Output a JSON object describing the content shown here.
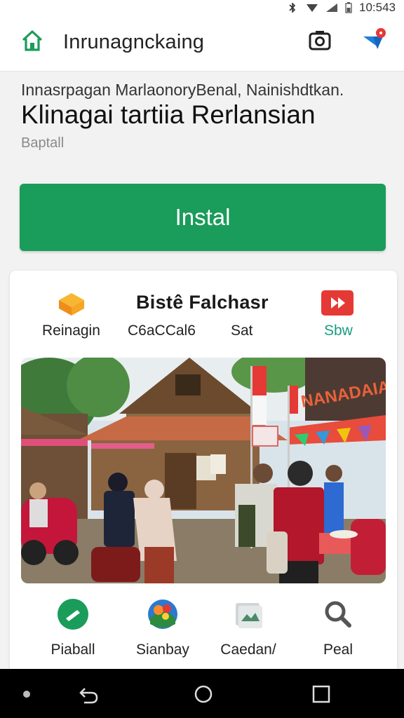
{
  "status_bar": {
    "time": "10:543",
    "icons": [
      "bluetooth-icon",
      "wifi-icon",
      "signal-icon",
      "battery-icon"
    ]
  },
  "app_bar": {
    "title": "Inrunagnckaing",
    "icons": [
      "home-icon",
      "camera-icon",
      "notification-icon"
    ]
  },
  "header": {
    "subtitle": "Innasrpagan MarlaonoryBenal, Nainishdtkan.",
    "headline": "Klinagai tartiia Rerlansian",
    "developer": "Baptall"
  },
  "install_button": {
    "label": "Instal"
  },
  "card": {
    "brand": "Bistê Falchasr",
    "top_items": [
      {
        "label": "Reinagin",
        "icon": "package-icon"
      },
      {
        "label": "C6aCCal6",
        "icon": ""
      },
      {
        "label": "Sat",
        "icon": ""
      },
      {
        "label": "Sbw",
        "icon": "video-play-icon"
      }
    ],
    "banner_text": "NANADAIA",
    "categories": [
      {
        "label": "Piaball",
        "icon": "pencil-circle-icon"
      },
      {
        "label": "Sianbay",
        "icon": "colorful-palette-icon"
      },
      {
        "label": "Caedan/",
        "icon": "image-icon"
      },
      {
        "label": "Peal",
        "icon": "search-icon"
      }
    ]
  },
  "colors": {
    "accent": "#1a9c5a",
    "teal": "#1a9c82",
    "youtube_red": "#e53935"
  },
  "nav_bar": {
    "icons": [
      "dot-icon",
      "back-icon",
      "home-circle-icon",
      "recents-square-icon"
    ]
  }
}
